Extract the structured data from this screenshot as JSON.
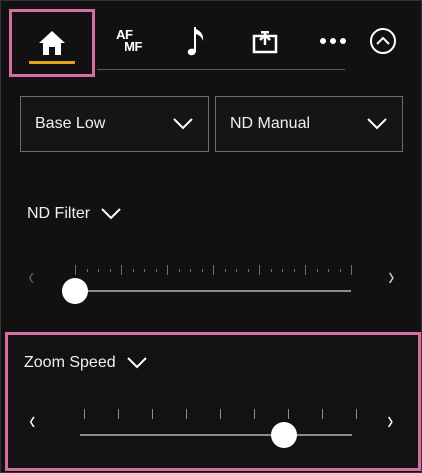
{
  "tabs": [
    {
      "name": "home",
      "icon": "home-icon"
    },
    {
      "name": "af-mf",
      "label_top": "AF",
      "label_bottom": "MF"
    },
    {
      "name": "audio",
      "icon": "music-note-icon"
    },
    {
      "name": "media",
      "icon": "upload-icon"
    },
    {
      "name": "more",
      "icon": "more-icon"
    },
    {
      "name": "collapse",
      "icon": "chevron-up-circle-icon"
    }
  ],
  "dropdowns": {
    "left_value": "Base Low",
    "right_value": "ND Manual"
  },
  "nd_filter": {
    "label": "ND Filter",
    "left_arrow": "‹",
    "right_arrow": "›",
    "level": 0.0,
    "state": "disabled"
  },
  "zoom_speed": {
    "label": "Zoom Speed",
    "left_arrow": "‹",
    "right_arrow": "›",
    "level": 0.75
  },
  "colors": {
    "highlight": "#d56ea0",
    "active_tab_underline": "#e6a315",
    "background": "#111111"
  }
}
